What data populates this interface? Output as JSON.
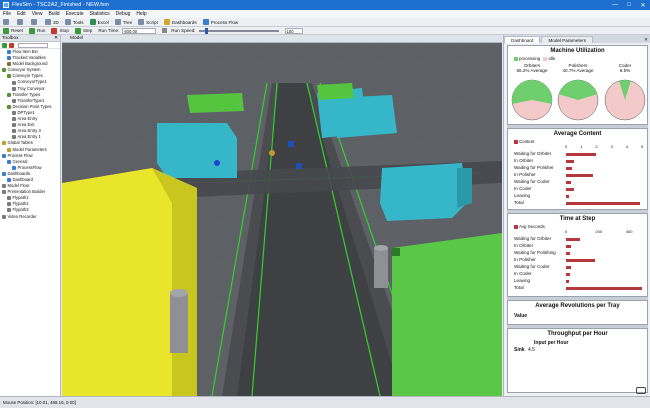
{
  "window": {
    "title": "FlexSim - TSC2A2_Finished - NEW.fsm",
    "minimize": "—",
    "maximize": "□",
    "close": "✕"
  },
  "menu": [
    "File",
    "Edit",
    "View",
    "Build",
    "Execute",
    "Statistics",
    "Debug",
    "Help"
  ],
  "toolbar": [
    "3D",
    "Tools",
    "Excel",
    "Tree",
    "Script",
    "Dashboards",
    "Process Flow"
  ],
  "runbar": {
    "reset": "Reset",
    "run": "Run",
    "stop": "Stop",
    "step": "Step",
    "run_time_label": "Run Time:",
    "run_time_value": "600.00",
    "speed_label": "Run Speed:",
    "speed_value": "100"
  },
  "toolbox": {
    "title": "Toolbox",
    "close": "✕",
    "items": [
      {
        "label": "Flow Item Bin",
        "indent": 1,
        "color": "#3b7bd1"
      },
      {
        "label": "Tracked Variables",
        "indent": 1,
        "color": "#3b7bd1"
      },
      {
        "label": "Model Background",
        "indent": 1,
        "color": "#8a6d3b"
      },
      {
        "label": "Conveyor System",
        "indent": 0,
        "color": "#5a8f3a"
      },
      {
        "label": "Conveyor Types",
        "indent": 1,
        "color": "#5a8f3a"
      },
      {
        "label": "ConveyorType1",
        "indent": 2,
        "color": "#7a7a7a"
      },
      {
        "label": "Tray Conveyor",
        "indent": 2,
        "color": "#7a7a7a"
      },
      {
        "label": "Transfer Types",
        "indent": 1,
        "color": "#5a8f3a"
      },
      {
        "label": "TransferType1",
        "indent": 2,
        "color": "#7a7a7a"
      },
      {
        "label": "Decision Point Types",
        "indent": 1,
        "color": "#5a8f3a"
      },
      {
        "label": "DPType1",
        "indent": 2,
        "color": "#7a7a7a"
      },
      {
        "label": "Area Entry",
        "indent": 2,
        "color": "#7a7a7a"
      },
      {
        "label": "Area Exit",
        "indent": 2,
        "color": "#7a7a7a"
      },
      {
        "label": "Area Entry 3",
        "indent": 2,
        "color": "#7a7a7a"
      },
      {
        "label": "Area Entry 1",
        "indent": 2,
        "color": "#7a7a7a"
      },
      {
        "label": "Global Tables",
        "indent": 0,
        "color": "#c89b2b"
      },
      {
        "label": "Model Parameters",
        "indent": 1,
        "color": "#c89b2b"
      },
      {
        "label": "Process Flow",
        "indent": 0,
        "color": "#3b7bd1"
      },
      {
        "label": "General",
        "indent": 1,
        "color": "#3b7bd1"
      },
      {
        "label": "ProcessFlow",
        "indent": 2,
        "color": "#3b7bd1"
      },
      {
        "label": "Dashboards",
        "indent": 0,
        "color": "#3b7bd1"
      },
      {
        "label": "Dashboard",
        "indent": 1,
        "color": "#3b7bd1"
      },
      {
        "label": "Model Floor",
        "indent": 0,
        "color": "#7a7a7a"
      },
      {
        "label": "Presentation Builder",
        "indent": 0,
        "color": "#7a7a7a"
      },
      {
        "label": "Flypath1",
        "indent": 1,
        "color": "#7a7a7a"
      },
      {
        "label": "Flypath2",
        "indent": 1,
        "color": "#7a7a7a"
      },
      {
        "label": "Flypath3",
        "indent": 1,
        "color": "#7a7a7a"
      },
      {
        "label": "Video Recorder",
        "indent": 0,
        "color": "#7a7a7a"
      }
    ]
  },
  "viewport": {
    "tab": "Model"
  },
  "right_panel": {
    "tabs": [
      "Dashboard",
      "Model Parameters"
    ],
    "close": "✕",
    "utilization": {
      "title": "Machine Utilization",
      "legend": [
        "processing",
        "idle"
      ],
      "machines": [
        {
          "name": "Orbiters",
          "average": "56.2% Average",
          "value": 56.2
        },
        {
          "name": "Polishers",
          "average": "40.7% Average",
          "value": 40.7
        },
        {
          "name": "Coder",
          "average": "9.5%",
          "value": 9.5
        }
      ],
      "colors": {
        "processing": "#6fcf6f",
        "idle": "#f4c9c9"
      }
    },
    "average_content": {
      "title": "Average Content",
      "legend": "Content",
      "rows": [
        "Waiting for Orbiter",
        "In Orbiter",
        "Waiting for Polisher",
        "In Polisher",
        "Waiting for Coder",
        "In Coder",
        "Leaving",
        "Total"
      ],
      "values": [
        2.0,
        0.5,
        0.4,
        1.8,
        0.3,
        0.5,
        0.2,
        4.9
      ],
      "ticks": [
        "0",
        "1",
        "2",
        "3",
        "4",
        "5"
      ]
    },
    "time_at_step": {
      "title": "Time at Step",
      "legend": "Avg Seconds",
      "rows": [
        "Waiting for Orbiter",
        "In Orbiter",
        "Waiting for Polishing",
        "In Polisher",
        "Waiting for Coder",
        "In Coder",
        "Leaving",
        "Total"
      ],
      "values": [
        90,
        30,
        25,
        190,
        35,
        25,
        20,
        500
      ],
      "ticks": [
        "0",
        "200",
        "400"
      ]
    },
    "revolutions": {
      "title": "Average Revolutions per Tray",
      "label": "Value"
    },
    "throughput": {
      "title": "Throughput per Hour",
      "col": "Input per Hour",
      "row_label": "Sink",
      "row_value": "4.5"
    }
  },
  "status": {
    "text": "Mouse Position: [10.01, 488.16, 0.00]"
  }
}
